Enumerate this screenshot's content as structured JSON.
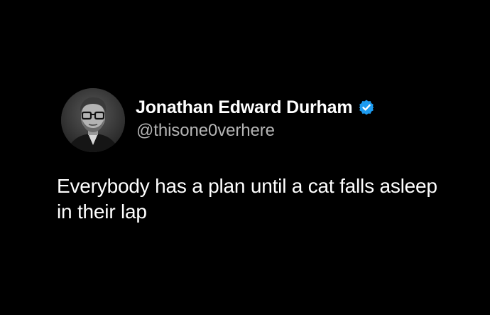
{
  "tweet": {
    "author": {
      "display_name": "Jonathan Edward Durham",
      "handle": "@thisone0verhere",
      "verified": true,
      "avatar_icon": "profile-photo"
    },
    "text": "Everybody has a plan until a cat falls asleep in their lap"
  },
  "colors": {
    "background": "#000000",
    "text_primary": "#ffffff",
    "text_secondary": "#b5b5b5",
    "verified_badge": "#1d9bf0"
  }
}
